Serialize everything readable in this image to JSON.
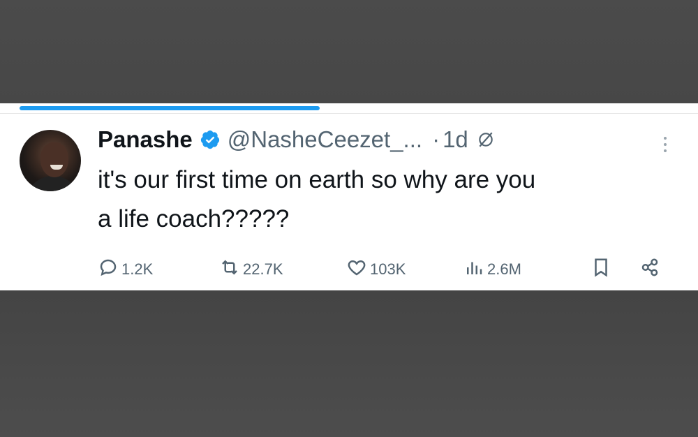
{
  "tweet": {
    "progress_fraction": 0.43,
    "author": {
      "name": "Panashe",
      "handle": "@NasheCeezet_...",
      "verified": true
    },
    "separator": "·",
    "time": "1d",
    "text_line1": "it's our first time on earth so why are you",
    "text_line2": "a life coach?????",
    "stats": {
      "replies": "1.2K",
      "retweets": "22.7K",
      "likes": "103K",
      "views": "2.6M"
    },
    "icons": {
      "verified": "verified-badge-icon",
      "grok": "grok-icon",
      "more": "more-icon",
      "reply": "reply-icon",
      "retweet": "retweet-icon",
      "like": "heart-icon",
      "views": "views-chart-icon",
      "bookmark": "bookmark-icon",
      "share": "share-icon"
    },
    "colors": {
      "accent": "#1d9bf0",
      "text": "#0f1419",
      "muted": "#536471",
      "background": "#4a4a4a"
    }
  }
}
